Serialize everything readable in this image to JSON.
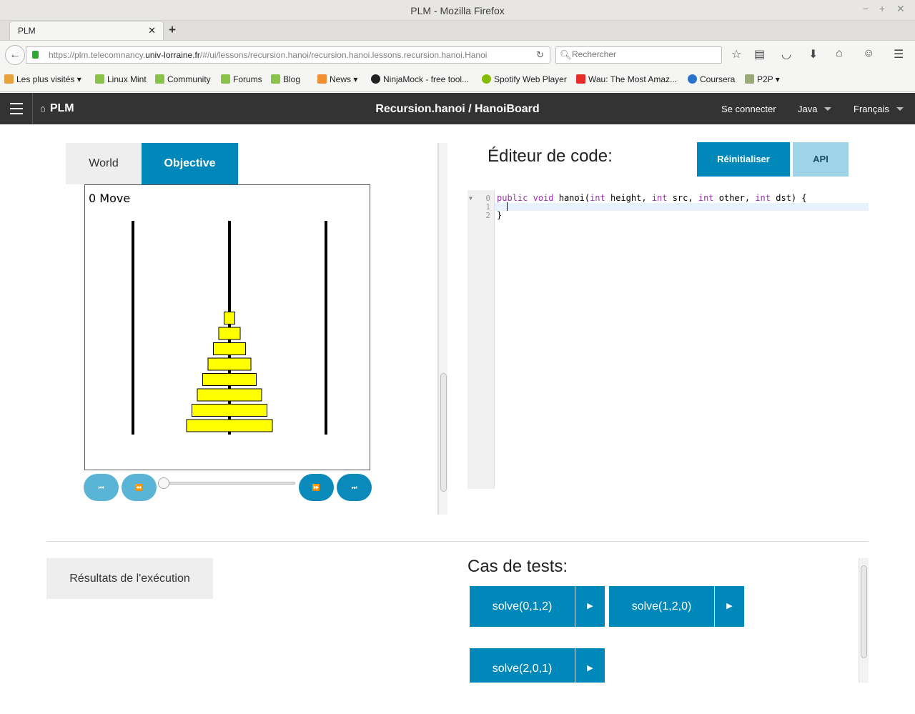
{
  "window": {
    "title": "PLM - Mozilla Firefox"
  },
  "browser": {
    "tab_label": "PLM",
    "url_prefix": "https://plm.telecomnancy.",
    "url_domain": "univ-lorraine.fr",
    "url_rest": "/#/ui/lessons/recursion.hanoi/recursion.hanoi.lessons.recursion.hanoi.Hanoi",
    "search_placeholder": "Rechercher",
    "bookmarks": [
      "Les plus visités",
      "Linux Mint",
      "Community",
      "Forums",
      "Blog",
      "News",
      "NinjaMock - free tool...",
      "Spotify Web Player",
      "Wau: The Most Amaz...",
      "Coursera",
      "P2P"
    ]
  },
  "appnav": {
    "brand": "PLM",
    "title": "Recursion.hanoi / HanoiBoard",
    "login": "Se connecter",
    "language": "Java",
    "locale": "Français"
  },
  "world": {
    "tab_world": "World",
    "tab_objective": "Objective",
    "move_counter": "0 Move",
    "pegs": 3,
    "discs_on_middle_peg": 8,
    "disc_color": "#ffff00"
  },
  "editor": {
    "title": "Éditeur de code:",
    "reset_label": "Réinitialiser",
    "api_label": "API",
    "line_numbers": [
      "0",
      "1",
      "2"
    ],
    "line0": {
      "kw1": "public",
      "sp1": " ",
      "kw2": "void",
      "a": " hanoi(",
      "kw3": "int",
      "b": " height, ",
      "kw4": "int",
      "c": " src, ",
      "kw5": "int",
      "d": " other, ",
      "kw6": "int",
      "e": " dst) {"
    },
    "line2": "}"
  },
  "results": {
    "label": "Résultats de l'exécution"
  },
  "tests": {
    "title": "Cas de tests:",
    "cases": [
      "solve(0,1,2)",
      "solve(1,2,0)",
      "solve(2,0,1)"
    ]
  },
  "colors": {
    "accent": "#0088bb",
    "nav_bg": "#333333",
    "accent_light": "#9fd3e8"
  }
}
